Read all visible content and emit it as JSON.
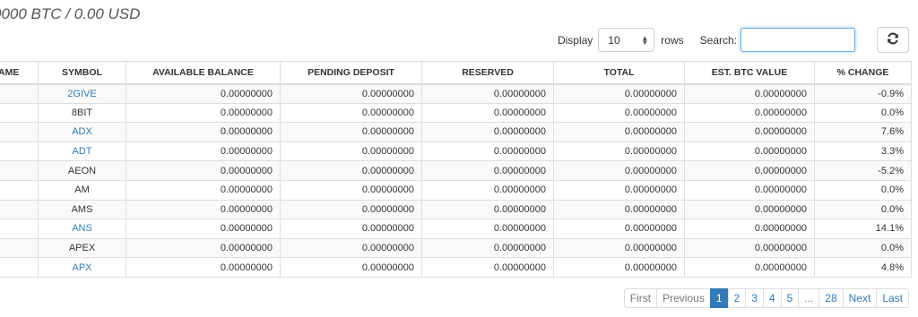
{
  "header": {
    "balance_text": "0000 BTC / 0.00 USD"
  },
  "controls": {
    "display_label": "Display",
    "rows_value": "10",
    "rows_label": "rows",
    "search_label": "Search:",
    "search_value": "",
    "refresh_icon": "refresh-icon"
  },
  "table": {
    "columns": [
      "AME",
      "SYMBOL",
      "AVAILABLE BALANCE",
      "PENDING DEPOSIT",
      "RESERVED",
      "TOTAL",
      "EST. BTC VALUE",
      "% CHANGE"
    ],
    "rows": [
      {
        "name": "",
        "symbol": "2GIVE",
        "symbol_link": true,
        "available": "0.00000000",
        "pending": "0.00000000",
        "reserved": "0.00000000",
        "total": "0.00000000",
        "btc_value": "0.00000000",
        "change": "-0.9%"
      },
      {
        "name": "",
        "symbol": "8BIT",
        "symbol_link": false,
        "available": "0.00000000",
        "pending": "0.00000000",
        "reserved": "0.00000000",
        "total": "0.00000000",
        "btc_value": "0.00000000",
        "change": "0.0%"
      },
      {
        "name": "",
        "symbol": "ADX",
        "symbol_link": true,
        "available": "0.00000000",
        "pending": "0.00000000",
        "reserved": "0.00000000",
        "total": "0.00000000",
        "btc_value": "0.00000000",
        "change": "7.6%"
      },
      {
        "name": "",
        "symbol": "ADT",
        "symbol_link": true,
        "available": "0.00000000",
        "pending": "0.00000000",
        "reserved": "0.00000000",
        "total": "0.00000000",
        "btc_value": "0.00000000",
        "change": "3.3%"
      },
      {
        "name": "",
        "symbol": "AEON",
        "symbol_link": false,
        "available": "0.00000000",
        "pending": "0.00000000",
        "reserved": "0.00000000",
        "total": "0.00000000",
        "btc_value": "0.00000000",
        "change": "-5.2%"
      },
      {
        "name": "",
        "symbol": "AM",
        "symbol_link": false,
        "available": "0.00000000",
        "pending": "0.00000000",
        "reserved": "0.00000000",
        "total": "0.00000000",
        "btc_value": "0.00000000",
        "change": "0.0%"
      },
      {
        "name": "",
        "symbol": "AMS",
        "symbol_link": false,
        "available": "0.00000000",
        "pending": "0.00000000",
        "reserved": "0.00000000",
        "total": "0.00000000",
        "btc_value": "0.00000000",
        "change": "0.0%"
      },
      {
        "name": "",
        "symbol": "ANS",
        "symbol_link": true,
        "available": "0.00000000",
        "pending": "0.00000000",
        "reserved": "0.00000000",
        "total": "0.00000000",
        "btc_value": "0.00000000",
        "change": "14.1%"
      },
      {
        "name": "",
        "symbol": "APEX",
        "symbol_link": false,
        "available": "0.00000000",
        "pending": "0.00000000",
        "reserved": "0.00000000",
        "total": "0.00000000",
        "btc_value": "0.00000000",
        "change": "0.0%"
      },
      {
        "name": "",
        "symbol": "APX",
        "symbol_link": true,
        "available": "0.00000000",
        "pending": "0.00000000",
        "reserved": "0.00000000",
        "total": "0.00000000",
        "btc_value": "0.00000000",
        "change": "4.8%"
      }
    ]
  },
  "pagination": {
    "first": "First",
    "previous": "Previous",
    "pages": [
      "1",
      "2",
      "3",
      "4",
      "5",
      "...",
      "28"
    ],
    "active_page": "1",
    "next": "Next",
    "last": "Last"
  },
  "colors": {
    "link": "#337ab7",
    "active_page_bg": "#337ab7",
    "search_focus": "#66afe9"
  }
}
